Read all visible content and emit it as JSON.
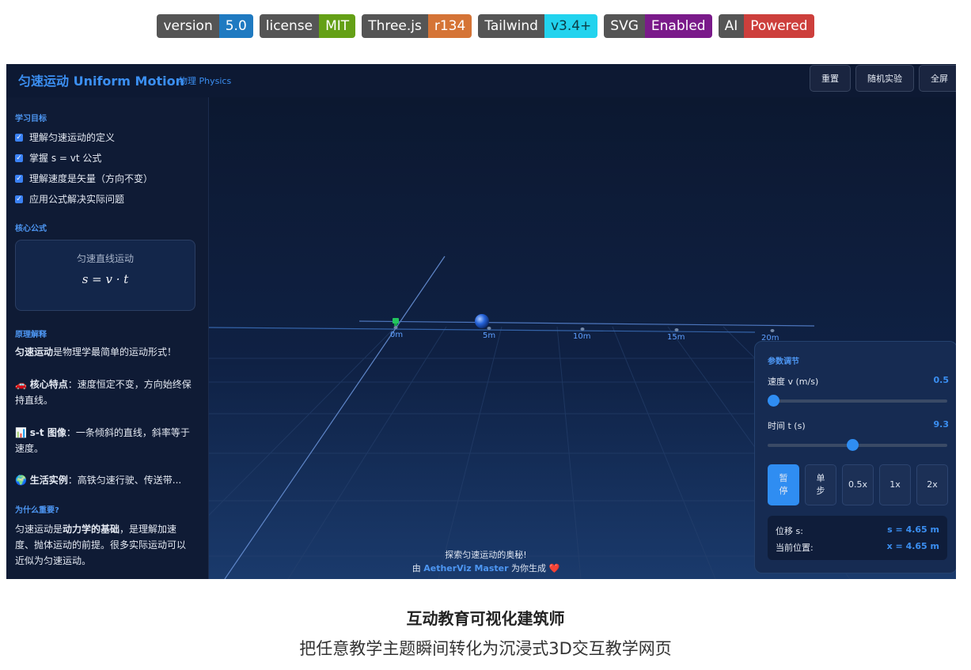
{
  "badges": [
    {
      "key": "version",
      "value": "5.0",
      "color": "#1f7ac1"
    },
    {
      "key": "license",
      "value": "MIT",
      "color": "#64a016"
    },
    {
      "key": "Three.js",
      "value": "r134",
      "color": "#d57436"
    },
    {
      "key": "Tailwind",
      "value": "v3.4+",
      "color": "#22d3ee"
    },
    {
      "key": "SVG",
      "value": "Enabled",
      "color": "#7a1a8a"
    },
    {
      "key": "AI",
      "value": "Powered",
      "color": "#cd3f3c"
    }
  ],
  "app": {
    "title": "匀速运动 Uniform Motion",
    "subtitle": "物理 Physics",
    "buttons": {
      "reset": "重置",
      "random": "随机实验",
      "fullscreen": "全屏"
    }
  },
  "sidebar": {
    "goals_title": "学习目标",
    "goals": [
      "理解匀速运动的定义",
      "掌握 s = vt 公式",
      "理解速度是矢量（方向不变）",
      "应用公式解决实际问题"
    ],
    "formula_section": "核心公式",
    "formula_title": "匀速直线运动",
    "formula": "s = v · t",
    "principle_title": "原理解释",
    "p1_bold": "匀速运动",
    "p1_rest": "是物理学最简单的运动形式！",
    "p2_icon": "🚗",
    "p2_bold": "核心特点",
    "p2_rest": "：速度恒定不变，方向始终保持直线。",
    "p3_icon": "📊",
    "p3_bold": "s-t 图像",
    "p3_rest": "：一条倾斜的直线，斜率等于速度。",
    "p4_icon": "🌍",
    "p4_bold": "生活实例",
    "p4_rest": "：高铁匀速行驶、传送带...",
    "why_title": "为什么重要?",
    "why_a": "匀速运动是",
    "why_bold": "动力学的基础",
    "why_b": "，是理解加速度、抛体运动的前提。很多实际运动可以近似为匀速运动。"
  },
  "scene": {
    "ticks": [
      "0m",
      "5m",
      "10m",
      "15m",
      "20m"
    ],
    "footer_line1": "探索匀速运动的奥秘!",
    "footer_by": "由 ",
    "footer_author": "AetherViz Master",
    "footer_suffix": " 为你生成 ❤️"
  },
  "panel": {
    "title": "参数调节",
    "speed_label": "速度 v (m/s)",
    "speed_value": "0.5",
    "speed_fraction": 0.0,
    "time_label": "时间 t (s)",
    "time_value": "9.3",
    "time_fraction": 0.47,
    "controls": [
      "暂停",
      "单步",
      "0.5x",
      "1x",
      "2x"
    ],
    "disp_label": "位移 s:",
    "disp_value": "s = 4.65 m",
    "pos_label": "当前位置:",
    "pos_value": "x = 4.65 m"
  },
  "heading": "互动教育可视化建筑师",
  "subheading": "把任意教学主题瞬间转化为沉浸式3D交互教学网页"
}
